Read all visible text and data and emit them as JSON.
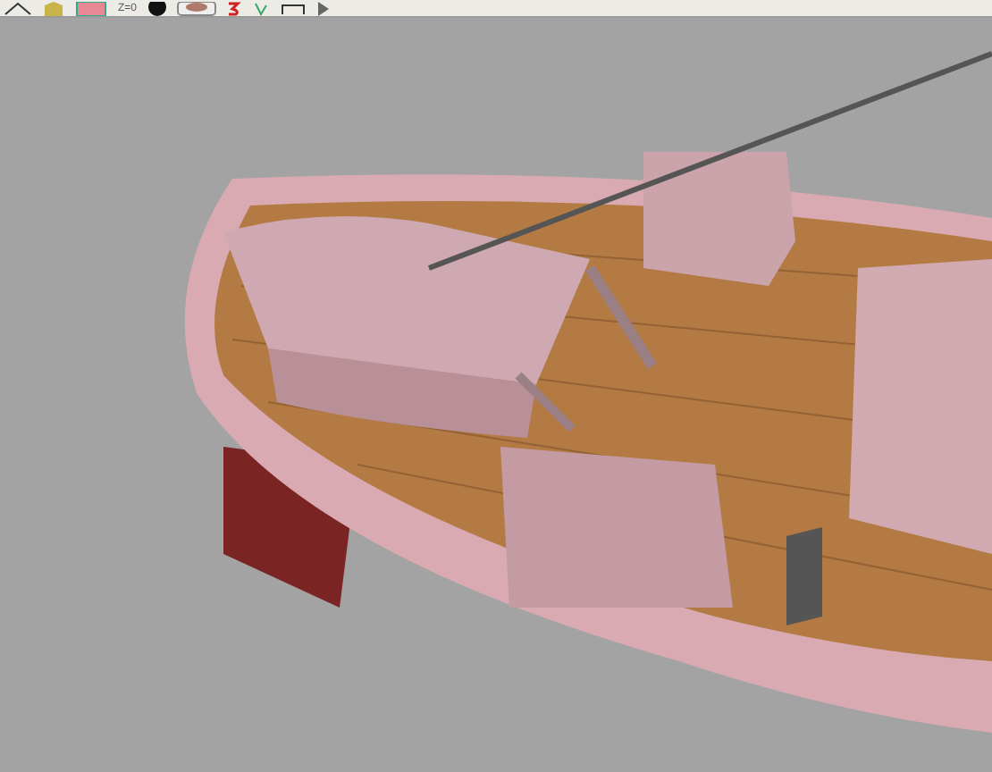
{
  "toolbar": {
    "items": [
      {
        "kind": "icon"
      },
      {
        "kind": "icon"
      },
      {
        "kind": "icon"
      },
      {
        "kind": "text",
        "label": "Z=0"
      },
      {
        "kind": "icon"
      },
      {
        "kind": "icon"
      },
      {
        "kind": "icon"
      },
      {
        "kind": "icon"
      },
      {
        "kind": "icon"
      },
      {
        "kind": "icon"
      }
    ]
  }
}
